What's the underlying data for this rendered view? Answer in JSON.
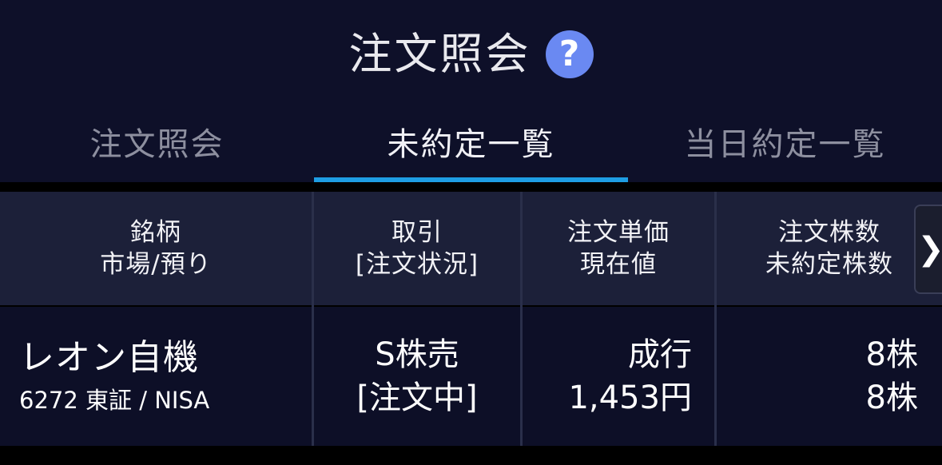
{
  "header": {
    "title": "注文照会",
    "help_icon": "question-circle-icon",
    "help_symbol": "?",
    "accent_color": "#6a89f2"
  },
  "tabs": [
    {
      "label": "注文照会",
      "active": false
    },
    {
      "label": "未約定一覧",
      "active": true
    },
    {
      "label": "当日約定一覧",
      "active": false
    }
  ],
  "tab_indicator_color": "#1e9de3",
  "table": {
    "columns": [
      {
        "line1": "銘柄",
        "line2": "市場/預り"
      },
      {
        "line1": "取引",
        "line2": "[注文状況]"
      },
      {
        "line1": "注文単価",
        "line2": "現在値"
      },
      {
        "line1": "注文株数",
        "line2": "未約定株数"
      }
    ],
    "scroll_right_symbol": "❯",
    "rows": [
      {
        "stock_name": "レオン自機",
        "stock_sub": "6272 東証 / NISA",
        "trade_type": "S株売",
        "order_status": "[注文中]",
        "order_price": "成行",
        "current_price": "1,453円",
        "order_qty": "8株",
        "unfilled_qty": "8株"
      }
    ]
  }
}
